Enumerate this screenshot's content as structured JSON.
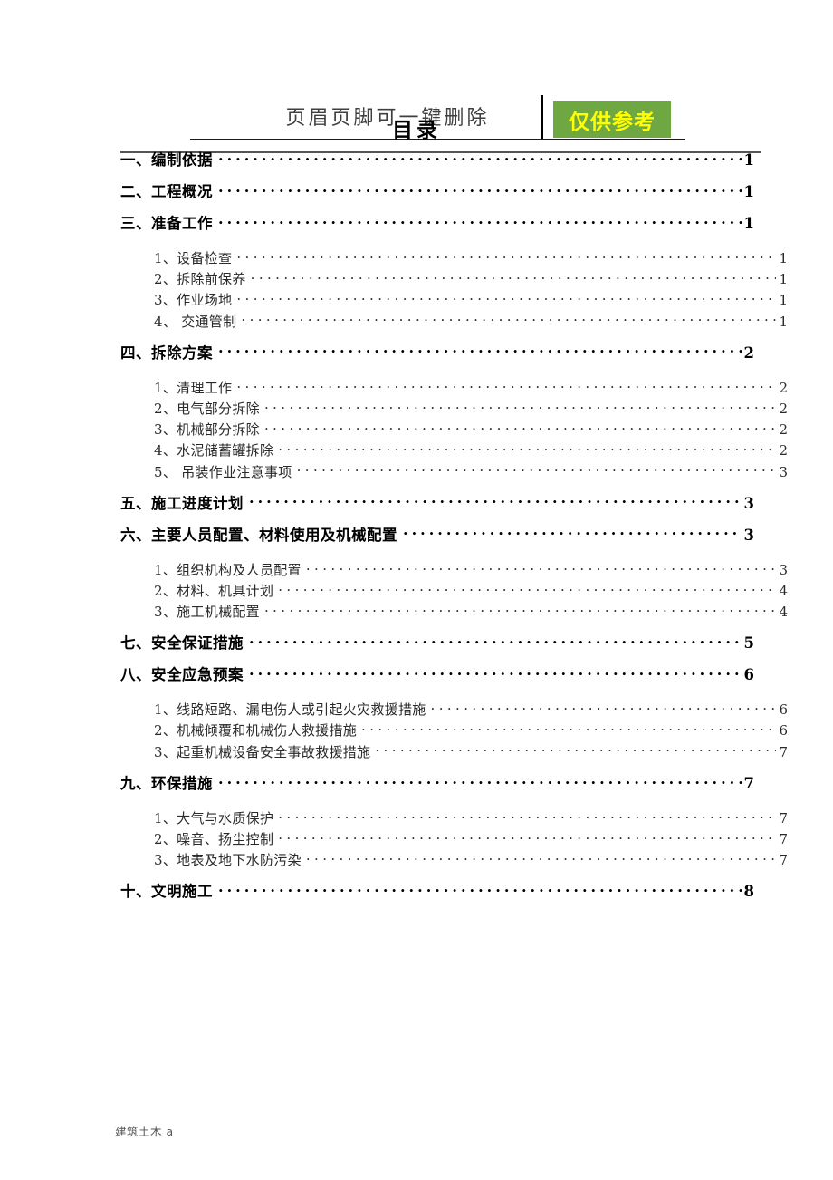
{
  "header": {
    "watermark_text": "页眉页脚可一键删除",
    "badge_text": "仅供参考",
    "badge_bg": "#6fa843",
    "badge_color": "#ffff00"
  },
  "document": {
    "title": "目录",
    "footer_text": "建筑土木 a"
  },
  "toc": {
    "entries": [
      {
        "level": 1,
        "label": "一、编制依据",
        "page": "1"
      },
      {
        "level": 1,
        "label": "二、工程概况",
        "page": "1"
      },
      {
        "level": 1,
        "label": "三、准备工作",
        "page": "1"
      },
      {
        "level": 2,
        "label": "1、设备检查",
        "page": "1"
      },
      {
        "level": 2,
        "label": "2、拆除前保养",
        "page": "1"
      },
      {
        "level": 2,
        "label": "3、作业场地",
        "page": "1"
      },
      {
        "level": 2,
        "label": "4、 交通管制",
        "page": "1"
      },
      {
        "level": 1,
        "label": "四、拆除方案",
        "page": "2"
      },
      {
        "level": 2,
        "label": "1、清理工作",
        "page": "2"
      },
      {
        "level": 2,
        "label": "2、电气部分拆除",
        "page": "2"
      },
      {
        "level": 2,
        "label": "3、机械部分拆除",
        "page": "2"
      },
      {
        "level": 2,
        "label": "4、水泥储蓄罐拆除",
        "page": "2"
      },
      {
        "level": 2,
        "label": "5、 吊装作业注意事项",
        "page": "3"
      },
      {
        "level": 1,
        "label": "五、施工进度计划",
        "page": "3"
      },
      {
        "level": 1,
        "label": "六、主要人员配置、材料使用及机械配置",
        "page": "3"
      },
      {
        "level": 2,
        "label": "1、组织机构及人员配置",
        "page": "3"
      },
      {
        "level": 2,
        "label": "2、材料、机具计划",
        "page": "4"
      },
      {
        "level": 2,
        "label": "3、施工机械配置",
        "page": "4"
      },
      {
        "level": 1,
        "label": "七、安全保证措施",
        "page": "5"
      },
      {
        "level": 1,
        "label": "八、安全应急预案",
        "page": "6"
      },
      {
        "level": 2,
        "label": "1、线路短路、漏电伤人或引起火灾救援措施",
        "page": "6"
      },
      {
        "level": 2,
        "label": "2、机械倾覆和机械伤人救援措施",
        "page": "6"
      },
      {
        "level": 2,
        "label": "3、起重机械设备安全事故救援措施",
        "page": "7"
      },
      {
        "level": 1,
        "label": "九、环保措施",
        "page": "7"
      },
      {
        "level": 2,
        "label": "1、大气与水质保护",
        "page": "7"
      },
      {
        "level": 2,
        "label": "2、噪音、扬尘控制",
        "page": "7"
      },
      {
        "level": 2,
        "label": "3、地表及地下水防污染",
        "page": "7"
      },
      {
        "level": 1,
        "label": "十、文明施工",
        "page": "8"
      }
    ]
  }
}
